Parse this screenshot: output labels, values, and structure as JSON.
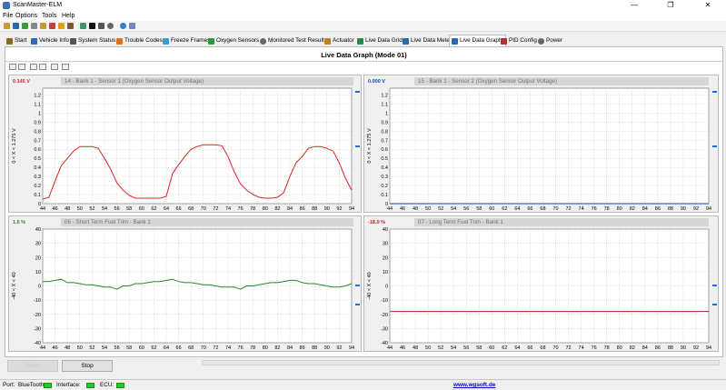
{
  "window": {
    "title": "ScanMaster-ELM",
    "min": "—",
    "max": "❐",
    "close": "✕"
  },
  "menu": [
    "File",
    "Options",
    "Tools",
    "Help"
  ],
  "tabs": [
    {
      "label": "Start",
      "icon": "home-icon",
      "color": "#8a6a2a"
    },
    {
      "label": "Vehicle Info",
      "icon": "info-icon",
      "color": "#2a6ab0"
    },
    {
      "label": "System Status",
      "icon": "status-icon",
      "color": "#555555"
    },
    {
      "label": "Trouble Codes",
      "icon": "warning-icon",
      "color": "#e07020"
    },
    {
      "label": "Freeze Frames",
      "icon": "snowflake-icon",
      "color": "#3a9ad0"
    },
    {
      "label": "Oxygen Sensors",
      "icon": "sensor-icon",
      "color": "#2a9a3a"
    },
    {
      "label": "Monitored Test Results",
      "icon": "gear-icon",
      "color": "#666666"
    },
    {
      "label": "Actuator",
      "icon": "actuator-icon",
      "color": "#c08020"
    },
    {
      "label": "Live Data Grid",
      "icon": "grid-icon",
      "color": "#2a8a4a"
    },
    {
      "label": "Live Data Meter",
      "icon": "meter-icon",
      "color": "#2a6ab0"
    },
    {
      "label": "Live Data Graph",
      "icon": "graph-icon",
      "color": "#2a6ab0"
    },
    {
      "label": "PID Config",
      "icon": "config-icon",
      "color": "#b03030"
    },
    {
      "label": "Power",
      "icon": "power-icon",
      "color": "#666666"
    }
  ],
  "active_tab": "Live Data Graph",
  "page_heading": "Live Data Graph (Mode 01)",
  "panels": [
    {
      "value": "0.145 V",
      "value_color": "#e02020",
      "title": "14 - Bank 1 - Sensor 1 (Oxygen Sensor Output Voltage)",
      "ylabel": "0  < X <  1.275  V"
    },
    {
      "value": "0.000 V",
      "value_color": "#1040d0",
      "title": "15 - Bank 1 - Sensor 2 (Oxygen Sensor Output Voltage)",
      "ylabel": "0  < X <  1.275  V"
    },
    {
      "value": "1.6 %",
      "value_color": "#2a8a2a",
      "title": "06 - Short Term Fuel Trim - Bank 1",
      "ylabel": "-40  < X <  40"
    },
    {
      "value": "-18.0 %",
      "value_color": "#c02020",
      "title": "07 - Long Term Fuel Trim - Bank 1",
      "ylabel": "-40  < X <  40"
    }
  ],
  "chart_data": [
    {
      "type": "line",
      "title": "14 - Bank 1 - Sensor 1 (Oxygen Sensor Output Voltage)",
      "xlim": [
        44,
        94
      ],
      "ylim": [
        0,
        1.275
      ],
      "xticks": [
        44,
        46,
        48,
        50,
        52,
        54,
        56,
        58,
        60,
        62,
        64,
        66,
        68,
        70,
        72,
        74,
        76,
        78,
        80,
        82,
        84,
        86,
        88,
        90,
        92,
        94
      ],
      "yticks": [
        "0",
        "0.1",
        "0.2",
        "0.3",
        "0.4",
        "0.5",
        "0.6",
        "0.7",
        "0.8",
        "0.9",
        "1",
        "1.1",
        "1.2"
      ],
      "series": [
        {
          "color": "#e02020",
          "x": [
            44,
            45,
            46,
            47,
            48,
            49,
            50,
            51,
            52,
            53,
            54,
            55,
            56,
            57,
            58,
            59,
            60,
            61,
            62,
            63,
            64,
            65,
            66,
            67,
            68,
            69,
            70,
            71,
            72,
            73,
            74,
            75,
            76,
            77,
            78,
            79,
            80,
            81,
            82,
            83,
            84,
            85,
            86,
            87,
            88,
            89,
            90,
            91,
            92,
            93,
            94
          ],
          "y": [
            0.05,
            0.07,
            0.25,
            0.42,
            0.5,
            0.58,
            0.63,
            0.63,
            0.63,
            0.61,
            0.5,
            0.38,
            0.23,
            0.15,
            0.09,
            0.06,
            0.06,
            0.06,
            0.06,
            0.06,
            0.08,
            0.33,
            0.43,
            0.52,
            0.6,
            0.63,
            0.65,
            0.65,
            0.65,
            0.64,
            0.52,
            0.35,
            0.22,
            0.15,
            0.1,
            0.07,
            0.06,
            0.06,
            0.07,
            0.12,
            0.3,
            0.45,
            0.52,
            0.61,
            0.63,
            0.63,
            0.61,
            0.58,
            0.45,
            0.28,
            0.15
          ]
        }
      ]
    },
    {
      "type": "line",
      "title": "15 - Bank 1 - Sensor 2 (Oxygen Sensor Output Voltage)",
      "xlim": [
        44,
        94
      ],
      "ylim": [
        0,
        1.275
      ],
      "xticks": [
        44,
        46,
        48,
        50,
        52,
        54,
        56,
        58,
        60,
        62,
        64,
        66,
        68,
        70,
        72,
        74,
        76,
        78,
        80,
        82,
        84,
        86,
        88,
        90,
        92,
        94
      ],
      "yticks": [
        "0",
        "0.1",
        "0.2",
        "0.3",
        "0.4",
        "0.5",
        "0.6",
        "0.7",
        "0.8",
        "0.9",
        "1",
        "1.1",
        "1.2"
      ],
      "series": [
        {
          "color": "#1040d0",
          "x": [
            44,
            94
          ],
          "y": [
            0,
            0
          ]
        }
      ]
    },
    {
      "type": "line",
      "title": "06 - Short Term Fuel Trim - Bank 1",
      "xlim": [
        44,
        94
      ],
      "ylim": [
        -40,
        40
      ],
      "xticks": [
        44,
        46,
        48,
        50,
        52,
        54,
        56,
        58,
        60,
        62,
        64,
        66,
        68,
        70,
        72,
        74,
        76,
        78,
        80,
        82,
        84,
        86,
        88,
        90,
        92,
        94
      ],
      "yticks": [
        "40",
        "30",
        "20",
        "10",
        "0",
        "-10",
        "-20",
        "-30",
        "-40"
      ],
      "series": [
        {
          "color": "#2a8a2a",
          "x": [
            44,
            45,
            46,
            47,
            48,
            49,
            50,
            51,
            52,
            53,
            54,
            55,
            56,
            57,
            58,
            59,
            60,
            61,
            62,
            63,
            64,
            65,
            66,
            67,
            68,
            69,
            70,
            71,
            72,
            73,
            74,
            75,
            76,
            77,
            78,
            79,
            80,
            81,
            82,
            83,
            84,
            85,
            86,
            87,
            88,
            89,
            90,
            91,
            92,
            93,
            94
          ],
          "y": [
            3.1,
            3.1,
            3.9,
            4.7,
            2.3,
            2.3,
            1.6,
            0.8,
            0.8,
            0,
            -0.8,
            -0.8,
            -2.3,
            0,
            0,
            1.6,
            1.6,
            2.3,
            3.1,
            3.1,
            3.9,
            4.7,
            3.1,
            2.3,
            2.3,
            1.6,
            0.8,
            0.8,
            0,
            -0.8,
            -0.8,
            -0.8,
            -2.3,
            0,
            0,
            0.8,
            1.6,
            2.3,
            2.3,
            3.1,
            3.9,
            3.9,
            2.3,
            1.6,
            1.6,
            0.8,
            0,
            -0.8,
            -0.8,
            0,
            1.6
          ]
        }
      ]
    },
    {
      "type": "line",
      "title": "07 - Long Term Fuel Trim - Bank 1",
      "xlim": [
        44,
        94
      ],
      "ylim": [
        -40,
        40
      ],
      "xticks": [
        44,
        46,
        48,
        50,
        52,
        54,
        56,
        58,
        60,
        62,
        64,
        66,
        68,
        70,
        72,
        74,
        76,
        78,
        80,
        82,
        84,
        86,
        88,
        90,
        92,
        94
      ],
      "yticks": [
        "40",
        "30",
        "20",
        "10",
        "0",
        "-10",
        "-20",
        "-30",
        "-40"
      ],
      "series": [
        {
          "color": "#b02020",
          "x": [
            44,
            94
          ],
          "y": [
            -18,
            -18
          ]
        }
      ]
    }
  ],
  "buttons": {
    "start": "Start",
    "stop": "Stop"
  },
  "status": {
    "port_label": "Port:",
    "port_value": "BlueTooth",
    "interface_label": "Interface:",
    "ecu_label": "ECU:",
    "url": "www.wgsoft.de",
    "led_color": "#1fd01f"
  }
}
